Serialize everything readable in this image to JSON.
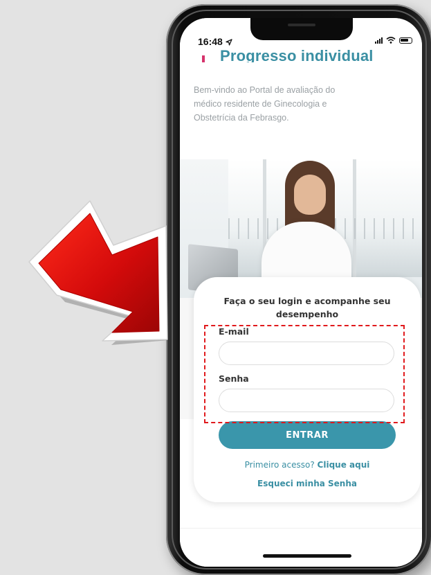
{
  "status_bar": {
    "time": "16:48"
  },
  "page": {
    "title": "Progresso individual",
    "intro": "Bem-vindo ao Portal de avaliação do médico residente de Ginecologia e Obstetrícia da Febrasgo."
  },
  "login": {
    "heading": "Faça o seu login e acompanhe seu desempenho",
    "email_label": "E-mail",
    "email_value": "",
    "password_label": "Senha",
    "password_value": "",
    "submit_label": "ENTRAR",
    "first_access_prefix": "Primeiro acesso?",
    "first_access_link": "Clique aqui",
    "forgot_label": "Esqueci minha Senha"
  },
  "colors": {
    "accent": "#3a96ab",
    "title": "#3a8fa3",
    "title_bar": "#d6336c",
    "highlight": "#e0191c",
    "arrow": "#d40b0b"
  },
  "icons": [
    "location-arrow-icon",
    "signal-icon",
    "wifi-icon",
    "battery-icon",
    "pointer-arrow-icon"
  ]
}
